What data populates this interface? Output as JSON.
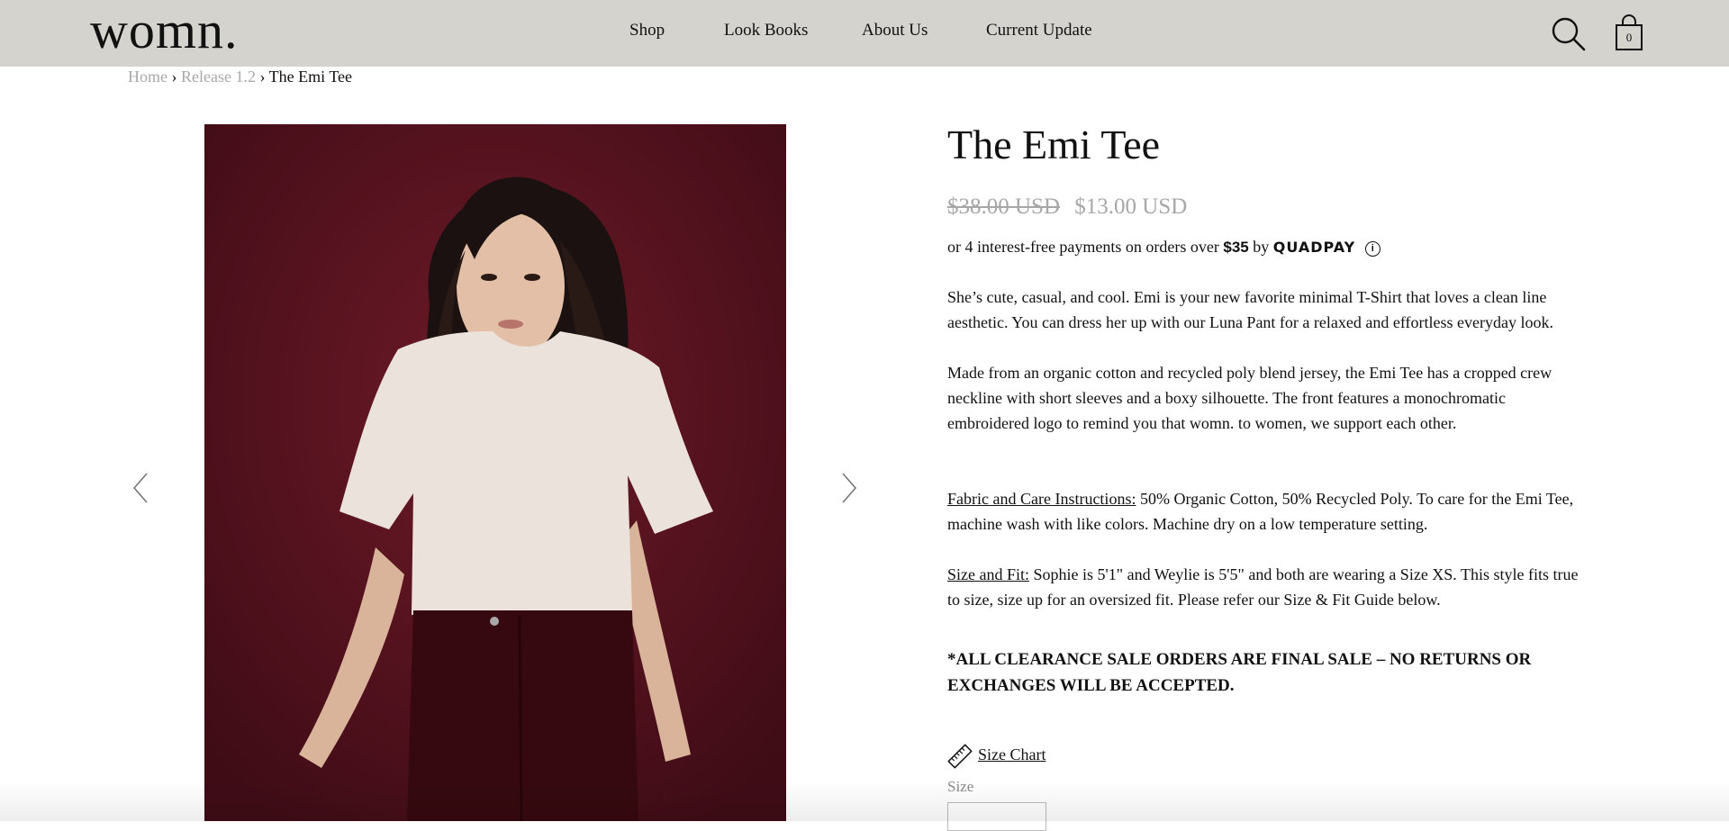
{
  "header": {
    "logo": "womn.",
    "nav": [
      "Shop",
      "Look Books",
      "About Us",
      "Current Update"
    ],
    "cart_count": "0",
    "bg_color": "#d5d3cd"
  },
  "breadcrumb": {
    "items": [
      "Home",
      "Release 1.2"
    ],
    "separator": "›",
    "current": "The Emi Tee"
  },
  "product": {
    "title": "The Emi Tee",
    "price_original": "$38.00 USD",
    "price_sale": "$13.00 USD",
    "installments": {
      "prefix": "or 4 interest-free payments on orders over",
      "amount": "$35",
      "by": "by",
      "provider": "QUADPAY"
    },
    "description_1": "She’s cute, casual, and cool. Emi is your new favorite minimal T-Shirt that loves a clean line aesthetic. You can dress her up with our Luna Pant for a relaxed and effortless everyday look.",
    "description_2": "Made from an organic cotton and recycled poly blend jersey, the Emi Tee has a cropped crew neckline with short sleeves and a boxy silhouette. The front features a monochromatic embroidered logo to remind you that womn. to women, we support each other.",
    "fabric_label": "Fabric and Care Instructions:",
    "fabric_text": " 50% Organic Cotton, 50% Recycled Poly. To care for the Emi Tee, machine wash with like colors. Machine dry on a low temperature setting.",
    "fit_label": "Size and Fit:",
    "fit_text": " Sophie is 5'1\" and Weylie is 5'5\" and both are wearing a Size XS. This style fits true to size, size up for an oversized fit. Please refer our Size & Fit Guide below.",
    "notice": "*ALL CLEARANCE SALE ORDERS ARE FINAL SALE – NO RETURNS OR EXCHANGES WILL BE ACCEPTED.",
    "size_chart_label": "Size Chart",
    "size_label": "Size",
    "image_bg_color": "#5a1320"
  },
  "icons": [
    "search-icon",
    "cart-icon",
    "info-icon",
    "chevron-left-icon",
    "chevron-right-icon",
    "ruler-icon"
  ]
}
